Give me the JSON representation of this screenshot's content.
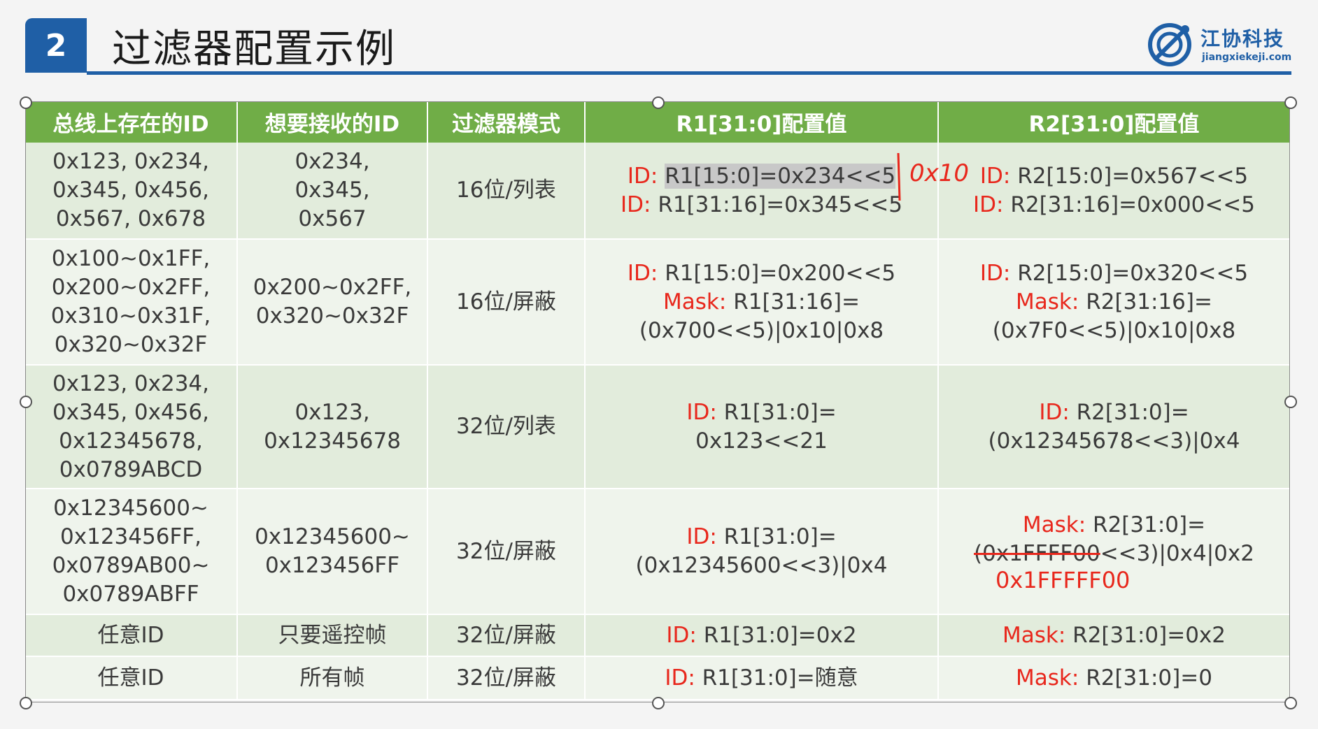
{
  "header": {
    "number": "2",
    "title": "过滤器配置示例",
    "logo_cn": "江协科技",
    "logo_en": "jiangxiekeji.com"
  },
  "table": {
    "columns": [
      "总线上存在的ID",
      "想要接收的ID",
      "过滤器模式",
      "R1[31:0]配置值",
      "R2[31:0]配置值"
    ],
    "rows": [
      {
        "bus_ids": [
          "0x123, 0x234,",
          "0x345, 0x456,",
          "0x567, 0x678"
        ],
        "want_ids": [
          "0x234,",
          "0x345,",
          "0x567"
        ],
        "mode": "16位/列表",
        "r1": [
          {
            "key": "ID:",
            "val": "R1[15:0]=0x234<<5"
          },
          {
            "key": "ID:",
            "val": "R1[31:16]=0x345<<5"
          }
        ],
        "r2": [
          {
            "key": "ID:",
            "val": "R2[15:0]=0x567<<5"
          },
          {
            "key": "ID:",
            "val": "R2[31:16]=0x000<<5"
          }
        ]
      },
      {
        "bus_ids": [
          "0x100~0x1FF,",
          "0x200~0x2FF,",
          "0x310~0x31F,",
          "0x320~0x32F"
        ],
        "want_ids": [
          "0x200~0x2FF,",
          "0x320~0x32F"
        ],
        "mode": "16位/屏蔽",
        "r1": [
          {
            "key": "ID:",
            "val": "R1[15:0]=0x200<<5"
          },
          {
            "key": "Mask:",
            "val": "R1[31:16]="
          },
          {
            "key": "",
            "val": "(0x700<<5)|0x10|0x8"
          }
        ],
        "r2": [
          {
            "key": "ID:",
            "val": "R2[15:0]=0x320<<5"
          },
          {
            "key": "Mask:",
            "val": "R2[31:16]="
          },
          {
            "key": "",
            "val": "(0x7F0<<5)|0x10|0x8"
          }
        ]
      },
      {
        "bus_ids": [
          "0x123, 0x234,",
          "0x345, 0x456,",
          "0x12345678,",
          "0x0789ABCD"
        ],
        "want_ids": [
          "0x123,",
          "0x12345678"
        ],
        "mode": "32位/列表",
        "r1": [
          {
            "key": "ID:",
            "val": "R1[31:0]="
          },
          {
            "key": "",
            "val": "0x123<<21"
          }
        ],
        "r2": [
          {
            "key": "ID:",
            "val": "R2[31:0]="
          },
          {
            "key": "",
            "val": "(0x12345678<<3)|0x4"
          }
        ]
      },
      {
        "bus_ids": [
          "0x12345600~",
          "0x123456FF,",
          "0x0789AB00~",
          "0x0789ABFF"
        ],
        "want_ids": [
          "0x12345600~",
          "0x123456FF"
        ],
        "mode": "32位/屏蔽",
        "r1": [
          {
            "key": "ID:",
            "val": "R1[31:0]="
          },
          {
            "key": "",
            "val": "(0x12345600<<3)|0x4"
          }
        ],
        "r2_mask_line": {
          "key": "Mask:",
          "val": "R2[31:0]="
        },
        "r2_struck": "(0x1FFFF00",
        "r2_rest": "<<3)|0x4|0x2",
        "r2_note": "0x1FFFFF00"
      },
      {
        "bus_ids": [
          "任意ID"
        ],
        "want_ids": [
          "只要遥控帧"
        ],
        "mode": "32位/屏蔽",
        "r1": [
          {
            "key": "ID:",
            "val": "R1[31:0]=0x2"
          }
        ],
        "r2": [
          {
            "key": "Mask:",
            "val": "R2[31:0]=0x2"
          }
        ]
      },
      {
        "bus_ids": [
          "任意ID"
        ],
        "want_ids": [
          "所有帧"
        ],
        "mode": "32位/屏蔽",
        "r1": [
          {
            "key": "ID:",
            "val": "R1[31:0]=随意"
          }
        ],
        "r2": [
          {
            "key": "Mask:",
            "val": "R2[31:0]=0"
          }
        ]
      }
    ],
    "handwritten_note": "0x10"
  },
  "colors": {
    "header_green": "#70ad47",
    "row_odd": "#e2ecdc",
    "row_even": "#eff4ec",
    "accent_blue": "#1f5fa6",
    "label_red": "#e8271c"
  }
}
